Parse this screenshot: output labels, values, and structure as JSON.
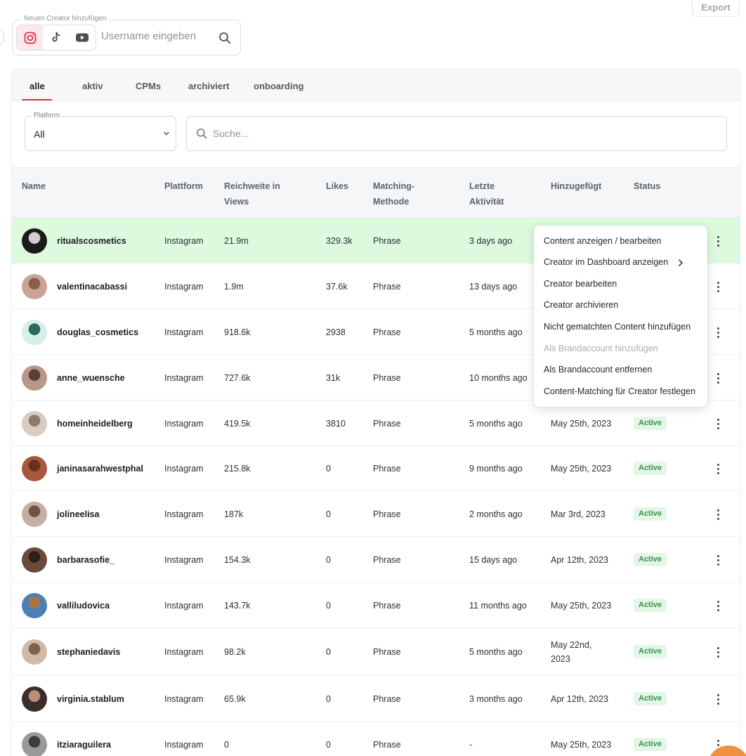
{
  "export_label": "Export",
  "add_creator": {
    "label": "Neuen Creator hinzufügen",
    "platform_icons": [
      "instagram-icon",
      "tiktok-icon",
      "youtube-icon"
    ],
    "username_placeholder": "Username eingeben"
  },
  "tabs": [
    {
      "label": "alle",
      "active": true
    },
    {
      "label": "aktiv",
      "active": false
    },
    {
      "label": "CPMs",
      "active": false
    },
    {
      "label": "archiviert",
      "active": false
    },
    {
      "label": "onboarding",
      "active": false
    }
  ],
  "filters": {
    "platform_label": "Platform",
    "platform_value": "All",
    "search_placeholder": "Suche..."
  },
  "table": {
    "headers": {
      "name": "Name",
      "platform": "Plattform",
      "reach_1": "Reichweite in",
      "reach_2": "Views",
      "likes": "Likes",
      "matching_1": "Matching-",
      "matching_2": "Methode",
      "activity_1": "Letzte",
      "activity_2": "Aktivität",
      "added": "Hinzugefügt",
      "status": "Status"
    },
    "rows": [
      {
        "name": "ritualscosmetics",
        "platform": "Instagram",
        "reach": "21.9m",
        "likes": "329.3k",
        "method": "Phrase",
        "activity": "3 days ago",
        "added_1": "",
        "added_2": "",
        "status": ""
      },
      {
        "name": "valentinacabassi",
        "platform": "Instagram",
        "reach": "1.9m",
        "likes": "37.6k",
        "method": "Phrase",
        "activity": "13 days ago",
        "added_1": "",
        "added_2": "",
        "status": ""
      },
      {
        "name": "douglas_cosmetics",
        "platform": "Instagram",
        "reach": "918.6k",
        "likes": "2938",
        "method": "Phrase",
        "activity": "5 months ago",
        "added_1": "",
        "added_2": "",
        "status": ""
      },
      {
        "name": "anne_wuensche",
        "platform": "Instagram",
        "reach": "727.6k",
        "likes": "31k",
        "method": "Phrase",
        "activity": "10 months ago",
        "added_1": "",
        "added_2": "",
        "status": ""
      },
      {
        "name": "homeinheidelberg",
        "platform": "Instagram",
        "reach": "419.5k",
        "likes": "3810",
        "method": "Phrase",
        "activity": "5 months ago",
        "added_1": "May 25th, 2023",
        "added_2": "",
        "status": "Active"
      },
      {
        "name": "janinasarahwestphal",
        "platform": "Instagram",
        "reach": "215.8k",
        "likes": "0",
        "method": "Phrase",
        "activity": "9 months ago",
        "added_1": "May 25th, 2023",
        "added_2": "",
        "status": "Active"
      },
      {
        "name": "jolineelisa",
        "platform": "Instagram",
        "reach": "187k",
        "likes": "0",
        "method": "Phrase",
        "activity": "2 months ago",
        "added_1": "Mar 3rd, 2023",
        "added_2": "",
        "status": "Active"
      },
      {
        "name": "barbarasofie_",
        "platform": "Instagram",
        "reach": "154.3k",
        "likes": "0",
        "method": "Phrase",
        "activity": "15 days ago",
        "added_1": "Apr 12th, 2023",
        "added_2": "",
        "status": "Active"
      },
      {
        "name": "valliludovica",
        "platform": "Instagram",
        "reach": "143.7k",
        "likes": "0",
        "method": "Phrase",
        "activity": "11 months ago",
        "added_1": "May 25th, 2023",
        "added_2": "",
        "status": "Active"
      },
      {
        "name": "stephaniedavis",
        "platform": "Instagram",
        "reach": "98.2k",
        "likes": "0",
        "method": "Phrase",
        "activity": "5 months ago",
        "added_1": "May 22nd,",
        "added_2": "2023",
        "status": "Active"
      },
      {
        "name": "virginia.stablum",
        "platform": "Instagram",
        "reach": "65.9k",
        "likes": "0",
        "method": "Phrase",
        "activity": "3 months ago",
        "added_1": "Apr 12th, 2023",
        "added_2": "",
        "status": "Active"
      },
      {
        "name": "itziaraguilera",
        "platform": "Instagram",
        "reach": "0",
        "likes": "0",
        "method": "Phrase",
        "activity": "-",
        "added_1": "May 25th, 2023",
        "added_2": "",
        "status": "Active"
      }
    ]
  },
  "context_menu": [
    {
      "label": "Content anzeigen / bearbeiten",
      "disabled": false
    },
    {
      "label": "Creator im Dashboard anzeigen",
      "disabled": false,
      "submenu": true
    },
    {
      "label": "Creator bearbeiten",
      "disabled": false
    },
    {
      "label": "Creator archivieren",
      "disabled": false
    },
    {
      "label": "Nicht gematchten Content hinzufügen",
      "disabled": false
    },
    {
      "label": "Als Brandaccount hinzufügen",
      "disabled": true
    },
    {
      "label": "Als Brandaccount entfernen",
      "disabled": false
    },
    {
      "label": "Content-Matching für Creator festlegen",
      "disabled": false
    }
  ],
  "colors": {
    "accent": "#e0344b",
    "highlight_row": "#ddfade",
    "status_bg": "#e2f7e6",
    "status_text": "#3a8f4f",
    "fab": "#f0913f"
  }
}
